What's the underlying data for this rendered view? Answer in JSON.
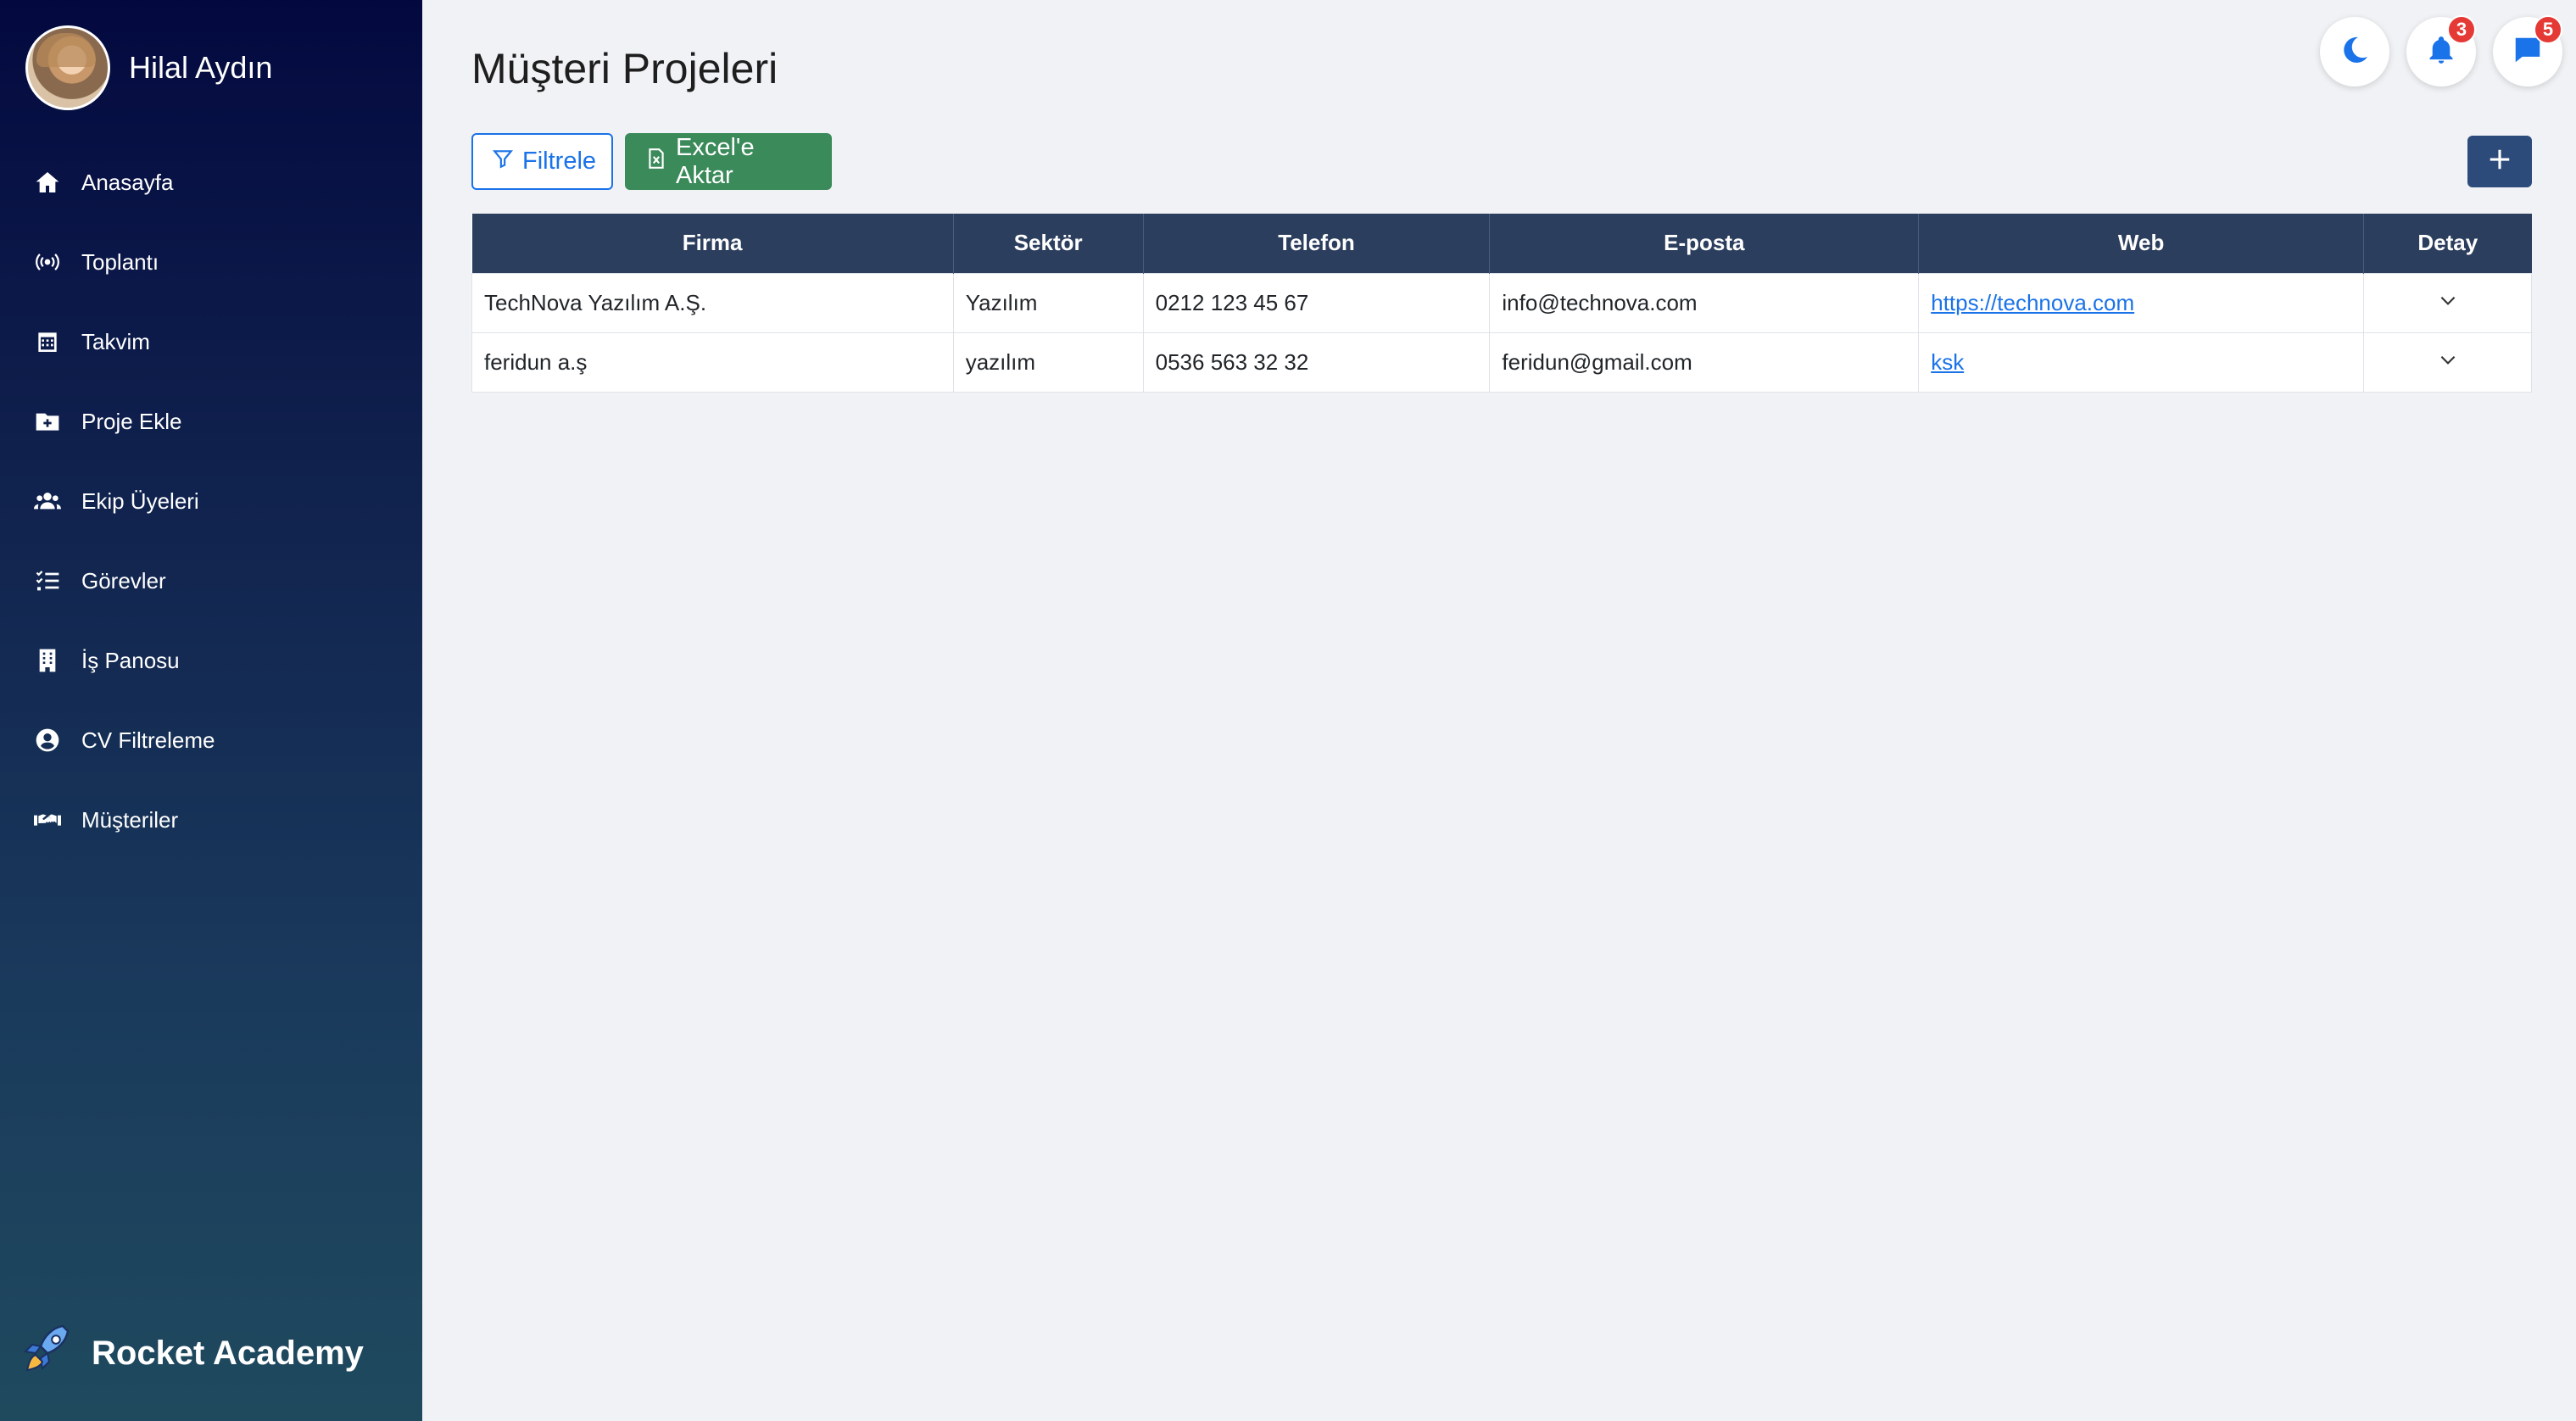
{
  "profile": {
    "name": "Hilal Aydın"
  },
  "sidebar": {
    "items": [
      {
        "label": "Anasayfa",
        "icon": "home-icon"
      },
      {
        "label": "Toplantı",
        "icon": "broadcast-icon"
      },
      {
        "label": "Takvim",
        "icon": "calendar-icon"
      },
      {
        "label": "Proje Ekle",
        "icon": "folder-plus-icon"
      },
      {
        "label": "Ekip Üyeleri",
        "icon": "users-icon"
      },
      {
        "label": "Görevler",
        "icon": "task-list-icon"
      },
      {
        "label": "İş Panosu",
        "icon": "building-icon"
      },
      {
        "label": "CV Filtreleme",
        "icon": "user-circle-icon"
      },
      {
        "label": "Müşteriler",
        "icon": "handshake-icon"
      }
    ]
  },
  "brand": {
    "name": "Rocket Academy"
  },
  "topbar": {
    "notifications_count": "3",
    "messages_count": "5"
  },
  "page": {
    "title": "Müşteri Projeleri"
  },
  "toolbar": {
    "filter_label": "Filtrele",
    "excel_label": "Excel'e Aktar"
  },
  "table": {
    "headers": {
      "firma": "Firma",
      "sektor": "Sektör",
      "telefon": "Telefon",
      "eposta": "E-posta",
      "web": "Web",
      "detay": "Detay"
    },
    "rows": [
      {
        "firma": "TechNova Yazılım A.Ş.",
        "sektor": "Yazılım",
        "telefon": "0212 123 45 67",
        "eposta": "info@technova.com",
        "web": "https://technova.com"
      },
      {
        "firma": "feridun a.ş",
        "sektor": "yazılım",
        "telefon": "0536 563 32 32",
        "eposta": "feridun@gmail.com",
        "web": "ksk"
      }
    ]
  },
  "colors": {
    "accent": "#1a73e8",
    "excel": "#3a8a5a",
    "table_header": "#2c3e5e",
    "badge": "#e53935"
  }
}
